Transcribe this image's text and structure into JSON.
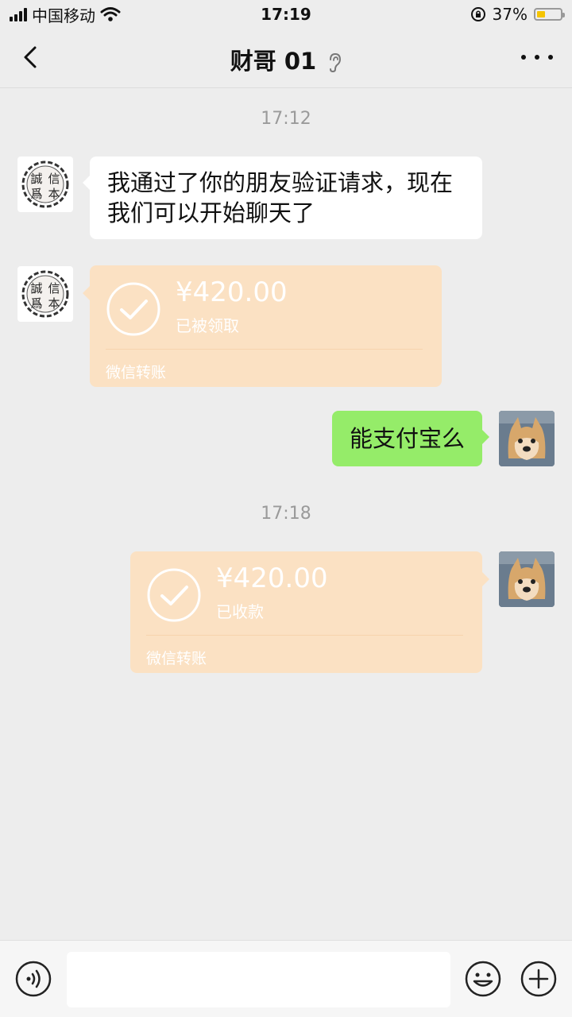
{
  "status_bar": {
    "carrier": "中国移动",
    "time": "17:19",
    "battery_text": "37%",
    "battery_level": 0.37
  },
  "header": {
    "title": "财哥 01",
    "icons": [
      "back-icon",
      "ear-icon",
      "more-icon"
    ]
  },
  "messages": [
    {
      "type": "timestamp",
      "text": "17:12"
    },
    {
      "type": "text",
      "side": "left",
      "text": "我通过了你的朋友验证请求，现在我们可以开始聊天了",
      "avatar_chars": [
        "誠",
        "信",
        "爲",
        "本"
      ]
    },
    {
      "type": "transfer",
      "side": "left",
      "amount": "¥420.00",
      "status": "已被领取",
      "label": "微信转账"
    },
    {
      "type": "text",
      "side": "right",
      "text": "能支付宝么"
    },
    {
      "type": "timestamp",
      "text": "17:18"
    },
    {
      "type": "transfer",
      "side": "right",
      "amount": "¥420.00",
      "status": "已收款",
      "label": "微信转账"
    }
  ],
  "input_bar": {
    "placeholder": "",
    "icons": [
      "voice-icon",
      "emoji-icon",
      "plus-icon"
    ]
  },
  "colors": {
    "background": "#ededed",
    "transfer_card": "#fbe1c3",
    "my_bubble": "#95ec69",
    "their_bubble": "#ffffff",
    "timestamp_text": "#9a9a9a"
  }
}
